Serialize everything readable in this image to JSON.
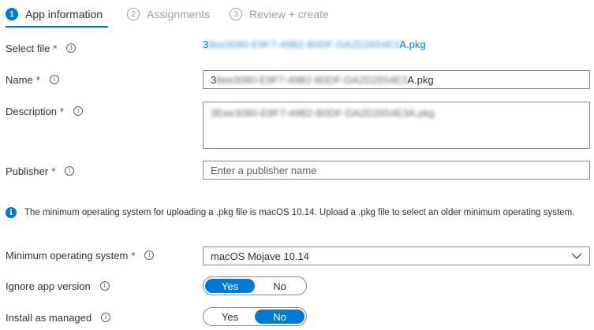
{
  "steps": [
    {
      "num": "1",
      "label": "App information"
    },
    {
      "num": "2",
      "label": "Assignments"
    },
    {
      "num": "3",
      "label": "Review + create"
    }
  ],
  "select_file": {
    "label": "Select file",
    "required": "*",
    "value_prefix": "3",
    "value_redacted": "8ee3080-E9F7-49B2-B0DF-DA2D2654E3",
    "value_suffix": "A.pkg"
  },
  "name": {
    "label": "Name",
    "required": "*",
    "value_prefix": "3",
    "value_redacted": "8ee3080-E9F7-49B2-B0DF-DA2D2654E3",
    "value_suffix": "A.pkg"
  },
  "description": {
    "label": "Description",
    "required": "*",
    "value_redacted": "3Eee3080-E9F7-49B2-B0DF-DA2D2654E3A.pkg"
  },
  "publisher": {
    "label": "Publisher",
    "required": "*",
    "placeholder": "Enter a publisher name"
  },
  "notice": {
    "icon": "info-filled-icon",
    "text": "The minimum operating system for uploading a .pkg file is macOS 10.14. Upload a .pkg file to select an older minimum operating system."
  },
  "min_os": {
    "label": "Minimum operating system",
    "required": "*",
    "value": "macOS Mojave 10.14"
  },
  "ignore_app_version": {
    "label": "Ignore app version",
    "yes": "Yes",
    "no": "No",
    "selected": "Yes"
  },
  "install_as_managed": {
    "label": "Install as managed",
    "yes": "Yes",
    "no": "No",
    "selected": "No"
  },
  "colors": {
    "accent": "#0078d4",
    "required": "#a4262c",
    "inactive": "#a19f9d"
  }
}
